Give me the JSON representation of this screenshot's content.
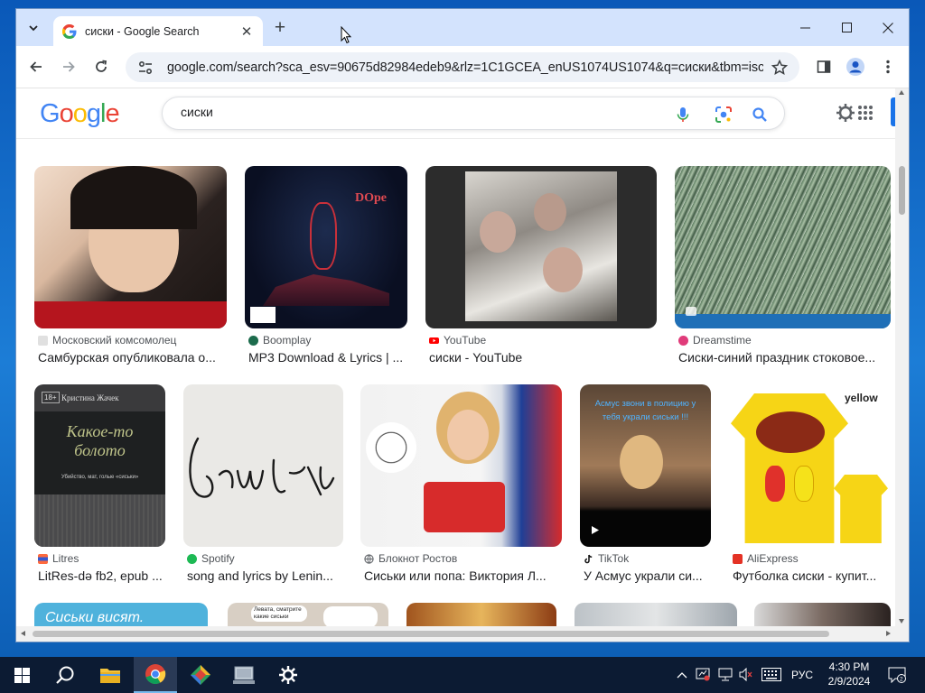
{
  "browser": {
    "tab_title": "сиски - Google Search",
    "url": "google.com/search?sca_esv=90675d82984edeb9&rlz=1C1GCEA_enUS1074US1074&q=сиски&tbm=isch&..."
  },
  "search": {
    "query": "сиски",
    "logo_text": "Google"
  },
  "results": [
    {
      "source": "Московский комсомолец",
      "caption": "Самбурская опубликовала о..."
    },
    {
      "source": "Boomplay",
      "caption": "MP3 Download & Lyrics | ...",
      "thumb_text": "DOpe"
    },
    {
      "source": "YouTube",
      "caption": "сиски - YouTube"
    },
    {
      "source": "Dreamstime",
      "caption": "Сиски-синий праздник стоковое..."
    },
    {
      "source": "Litres",
      "caption": "LitRes-də fb2, epub ...",
      "thumb_author": "Кристина Жачек",
      "thumb_title": "Какое-то болото",
      "thumb_badge": "18+",
      "thumb_tagline": "Убийство, мат, голые «сиськи»"
    },
    {
      "source": "Spotify",
      "caption": "song and lyrics by Lenin..."
    },
    {
      "source": "Блокнот Ростов",
      "caption": "Сиськи или попа: Виктория Л..."
    },
    {
      "source": "TikTok",
      "caption": "У Асмус украли си...",
      "thumb_text": "Асмус звони в полицию у тебя украли сиськи !!!"
    },
    {
      "source": "AliExpress",
      "caption": "Футболка сиски - купит...",
      "thumb_text": "yellow"
    },
    {
      "source": "",
      "caption": "",
      "thumb_text": "Сиськи висят."
    },
    {
      "source": "",
      "caption": "",
      "thumb_text": "Левата, сматрите какие сиськи"
    }
  ],
  "taskbar": {
    "time": "4:30 PM",
    "date": "2/9/2024",
    "lang": "РУС"
  },
  "colors": {
    "tabstrip": "#d3e3fd",
    "taskbar": "#0c1b33",
    "link_blue": "#1a73e8"
  }
}
